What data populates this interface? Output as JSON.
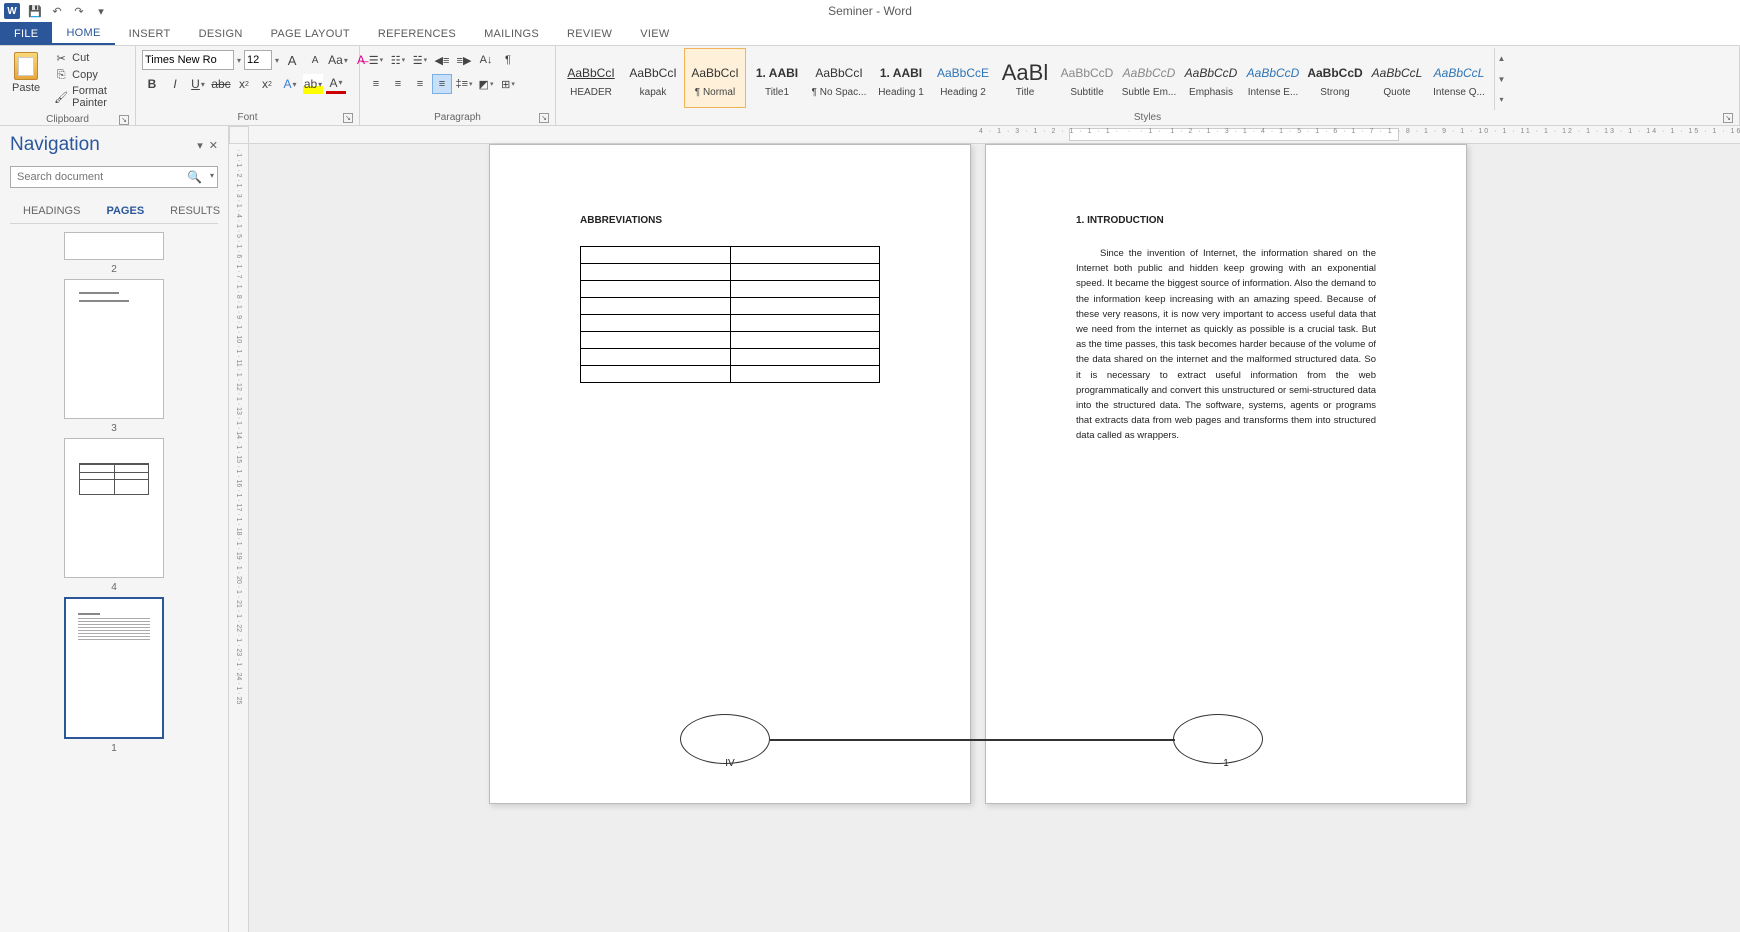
{
  "app": {
    "title": "Seminer - Word"
  },
  "qat": {
    "save": "💾",
    "undo": "↶",
    "redo": "↷",
    "more": "▾"
  },
  "tabs": [
    "FILE",
    "HOME",
    "INSERT",
    "DESIGN",
    "PAGE LAYOUT",
    "REFERENCES",
    "MAILINGS",
    "REVIEW",
    "VIEW"
  ],
  "clipboard": {
    "group": "Clipboard",
    "paste": "Paste",
    "cut": "Cut",
    "copy": "Copy",
    "format_painter": "Format Painter"
  },
  "font": {
    "group": "Font",
    "name": "Times New Ro",
    "size": "12"
  },
  "paragraph": {
    "group": "Paragraph"
  },
  "styles": {
    "group": "Styles",
    "items": [
      {
        "preview": "AaBbCcI",
        "name": "HEADER",
        "u": true
      },
      {
        "preview": "AaBbCcI",
        "name": "kapak"
      },
      {
        "preview": "AaBbCcI",
        "name": "¶ Normal"
      },
      {
        "preview": "1. AABI",
        "name": "Title1",
        "b": true
      },
      {
        "preview": "AaBbCcI",
        "name": "¶ No Spac..."
      },
      {
        "preview": "1. AABI",
        "name": "Heading 1",
        "b": true
      },
      {
        "preview": "AaBbCcE",
        "name": "Heading 2",
        "c": "#2e74b5"
      },
      {
        "preview": "AaBl",
        "name": "Title",
        "big": true
      },
      {
        "preview": "AaBbCcD",
        "name": "Subtitle",
        "c": "#888"
      },
      {
        "preview": "AaBbCcD",
        "name": "Subtle Em...",
        "c": "#888",
        "i": true
      },
      {
        "preview": "AaBbCcD",
        "name": "Emphasis",
        "i": true
      },
      {
        "preview": "AaBbCcD",
        "name": "Intense E...",
        "c": "#2e74b5",
        "i": true
      },
      {
        "preview": "AaBbCcD",
        "name": "Strong",
        "b": true
      },
      {
        "preview": "AaBbCcL",
        "name": "Quote",
        "i": true
      },
      {
        "preview": "AaBbCcL",
        "name": "Intense Q...",
        "c": "#2e74b5",
        "i": true
      }
    ]
  },
  "nav": {
    "title": "Navigation",
    "search_placeholder": "Search document",
    "tabs": [
      "HEADINGS",
      "PAGES",
      "RESULTS"
    ],
    "pages": [
      "2",
      "3",
      "4",
      "1"
    ]
  },
  "doc": {
    "left": {
      "heading": "ABBREVIATIONS",
      "footer": "IV"
    },
    "right": {
      "heading": "1. INTRODUCTION",
      "body": "Since the invention of Internet, the information shared on the Internet both public and hidden keep growing with an exponential speed. It became the biggest source of information. Also the demand to the information keep increasing with an amazing speed. Because of these very reasons, it is now very important to access useful data that we need from the internet as quickly as possible is a crucial task. But as the time passes, this task becomes harder because of the volume of the data shared on the internet and the malformed structured data. So it is necessary to extract useful information from the web programmatically and convert this unstructured or semi-structured data into the structured data. The software, systems, agents or programs that extracts data from web pages and transforms them into structured data called as wrappers.",
      "footer": "1"
    }
  }
}
